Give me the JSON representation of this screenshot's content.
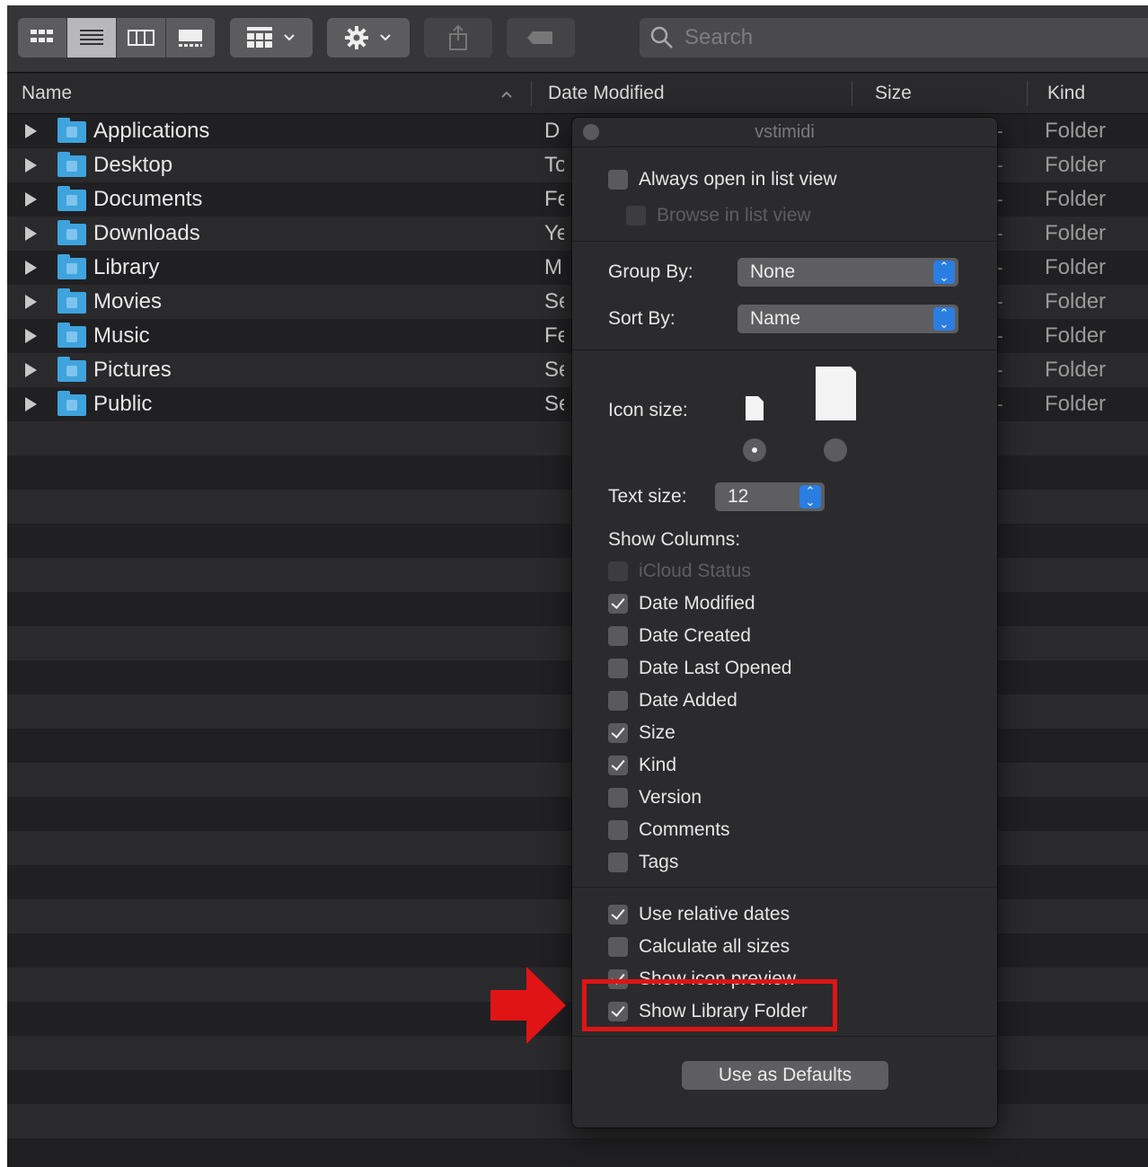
{
  "toolbar": {
    "view_buttons": [
      "icon-view",
      "list-view",
      "column-view",
      "gallery-view"
    ],
    "search_placeholder": "Search"
  },
  "columns": {
    "name": "Name",
    "date_modified": "Date Modified",
    "size": "Size",
    "kind": "Kind"
  },
  "rows": [
    {
      "name": "Applications",
      "date": "D",
      "size": "--",
      "kind": "Folder"
    },
    {
      "name": "Desktop",
      "date": "To",
      "size": "--",
      "kind": "Folder"
    },
    {
      "name": "Documents",
      "date": "Fe",
      "size": "--",
      "kind": "Folder"
    },
    {
      "name": "Downloads",
      "date": "Ye",
      "size": "--",
      "kind": "Folder"
    },
    {
      "name": "Library",
      "date": "M",
      "size": "--",
      "kind": "Folder"
    },
    {
      "name": "Movies",
      "date": "Se",
      "size": "--",
      "kind": "Folder"
    },
    {
      "name": "Music",
      "date": "Fe",
      "size": "--",
      "kind": "Folder"
    },
    {
      "name": "Pictures",
      "date": "Se",
      "size": "--",
      "kind": "Folder"
    },
    {
      "name": "Public",
      "date": "Se",
      "size": "--",
      "kind": "Folder"
    }
  ],
  "view_options": {
    "title": "vstimidi",
    "always_open": "Always open in list view",
    "browse_in": "Browse in list view",
    "group_by_label": "Group By:",
    "group_by_value": "None",
    "sort_by_label": "Sort By:",
    "sort_by_value": "Name",
    "icon_size_label": "Icon size:",
    "text_size_label": "Text size:",
    "text_size_value": "12",
    "show_columns_label": "Show Columns:",
    "columns": [
      {
        "label": "iCloud Status",
        "checked": false,
        "disabled": true
      },
      {
        "label": "Date Modified",
        "checked": true,
        "disabled": false
      },
      {
        "label": "Date Created",
        "checked": false,
        "disabled": false
      },
      {
        "label": "Date Last Opened",
        "checked": false,
        "disabled": false
      },
      {
        "label": "Date Added",
        "checked": false,
        "disabled": false
      },
      {
        "label": "Size",
        "checked": true,
        "disabled": false
      },
      {
        "label": "Kind",
        "checked": true,
        "disabled": false
      },
      {
        "label": "Version",
        "checked": false,
        "disabled": false
      },
      {
        "label": "Comments",
        "checked": false,
        "disabled": false
      },
      {
        "label": "Tags",
        "checked": false,
        "disabled": false
      }
    ],
    "options": [
      {
        "label": "Use relative dates",
        "checked": true
      },
      {
        "label": "Calculate all sizes",
        "checked": false
      },
      {
        "label": "Show icon preview",
        "checked": true
      },
      {
        "label": "Show Library Folder",
        "checked": true
      }
    ],
    "defaults_button": "Use as Defaults"
  },
  "colors": {
    "highlight": "#e01414",
    "accent": "#2a7de1",
    "folder": "#3fa4dd"
  }
}
